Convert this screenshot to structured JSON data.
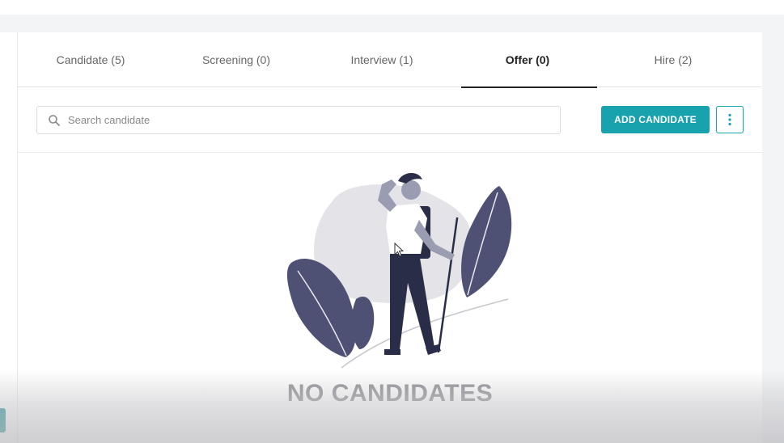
{
  "tabs": [
    {
      "label": "Candidate (5)",
      "active": false
    },
    {
      "label": "Screening (0)",
      "active": false
    },
    {
      "label": "Interview (1)",
      "active": false
    },
    {
      "label": "Offer (0)",
      "active": true
    },
    {
      "label": "Hire (2)",
      "active": false
    }
  ],
  "search": {
    "placeholder": "Search candidate",
    "value": "",
    "icon": "search-icon"
  },
  "toolbar": {
    "add_label": "ADD CANDIDATE",
    "more_icon": "vertical-dots-icon"
  },
  "empty_state": {
    "title": "NO CANDIDATES"
  },
  "colors": {
    "accent": "#17a2ad",
    "illustration_dark": "#4e5173",
    "illustration_navy": "#2a2d47",
    "empty_text": "#8f8f94"
  }
}
